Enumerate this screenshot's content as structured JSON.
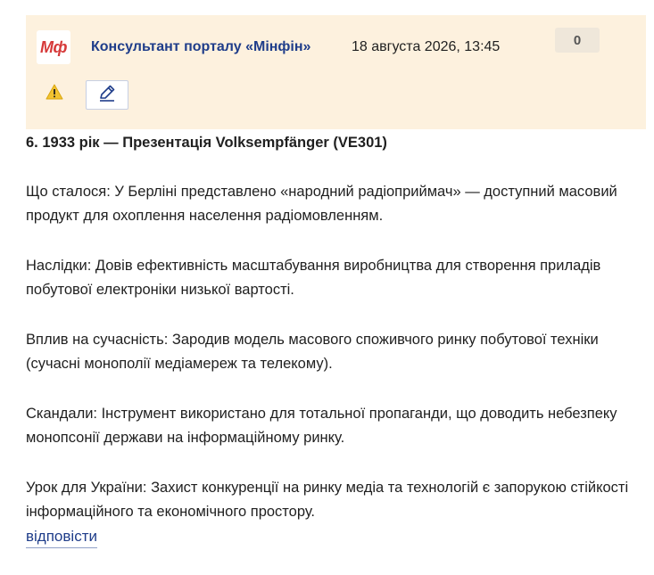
{
  "comment": {
    "logo_text": "Мф",
    "author": "Консультант порталу «Мінфін»",
    "date": "18 августа 2026, 13:45",
    "rating": "0",
    "warning_icon": "warning-icon",
    "edit_icon": "pencil-icon"
  },
  "body": {
    "title": "6. 1933 рік — Презентація Volksempfänger (VE301)",
    "paragraphs": [
      "Що сталося: У Берліні представлено «народний радіоприймач» — доступний масовий продукт для охоплення населення радіомовленням.",
      "Наслідки: Довів ефективність масштабування виробництва для створення приладів побутової електроніки низької вартості.",
      "Вплив на сучасність: Зародив модель масового споживчого ринку побутової техніки (сучасні монополії медіамереж та телекому).",
      "Скандали: Інструмент використано для тотальної пропаганди, що доводить небезпеку монопсонії держави на інформаційному ринку.",
      "Урок для України: Захист конкуренції на ринку медіа та технологій є запорукою стійкості інформаційного та економічного простору."
    ]
  },
  "actions": {
    "reply_label": "відповісти"
  },
  "colors": {
    "header_bg": "#fdf1de",
    "author": "#1f3d8a",
    "logo": "#d63a3a",
    "warning": "#f2c230"
  }
}
